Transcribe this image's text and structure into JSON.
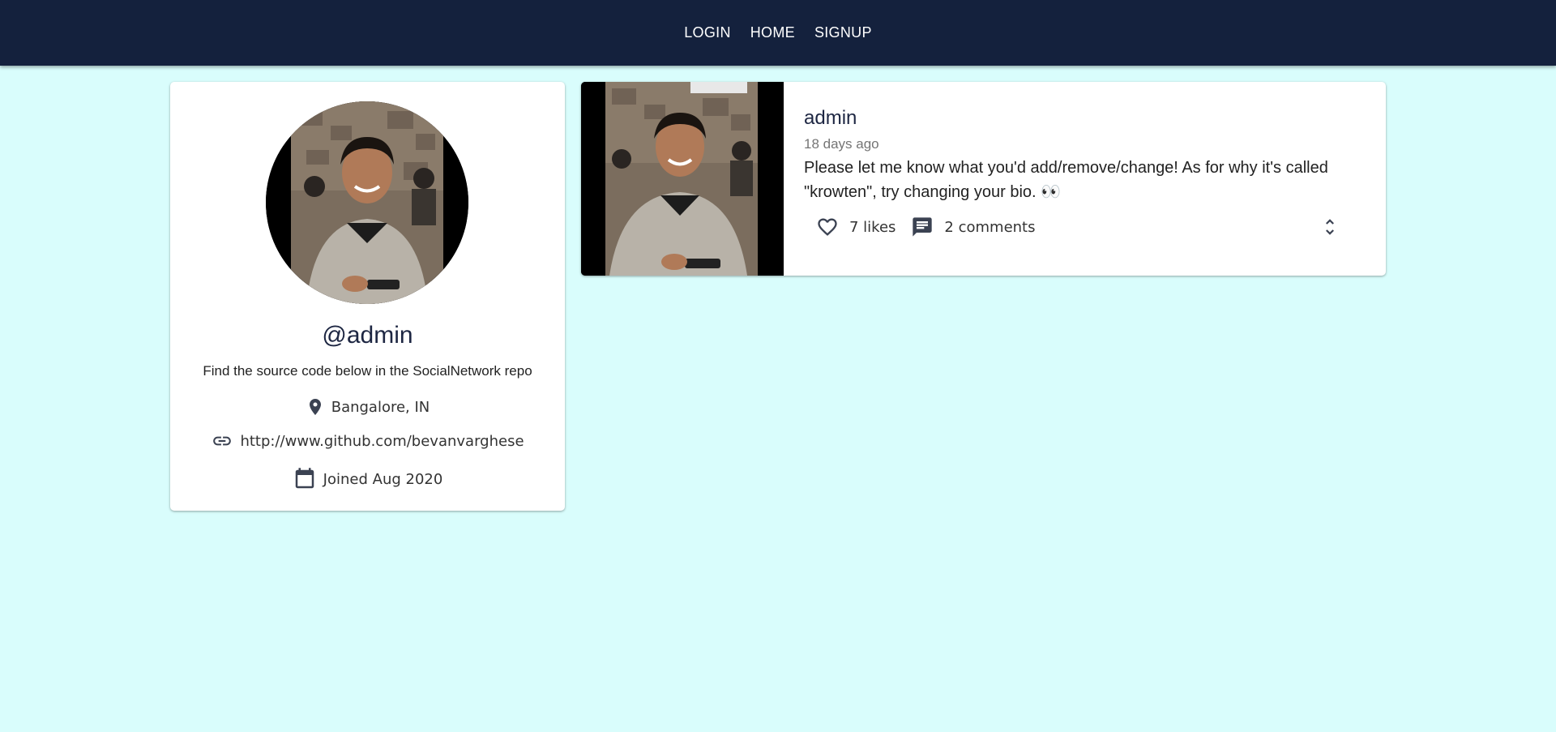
{
  "nav": {
    "items": [
      "LOGIN",
      "HOME",
      "SIGNUP"
    ]
  },
  "profile": {
    "handle": "@admin",
    "bio": "Find the source code below in the SocialNetwork repo",
    "location": "Bangalore, IN",
    "website": "http://www.github.com/bevanvarghese",
    "joined": "Joined Aug 2020",
    "icons": [
      "location-pin-icon",
      "link-icon",
      "calendar-icon"
    ]
  },
  "post": {
    "username": "admin",
    "time": "18 days ago",
    "body": "Please let me know what you'd add/remove/change! As for why it's called \"krowten\", try changing your bio. 👀",
    "likes": "7 likes",
    "comments": "2 comments",
    "icons": [
      "heart-outline-icon",
      "comment-icon",
      "unfold-more-icon"
    ]
  },
  "colors": {
    "navbar": "#14213d",
    "background": "#d9fdfc",
    "card": "#ffffff",
    "icon": "#3b4252"
  }
}
